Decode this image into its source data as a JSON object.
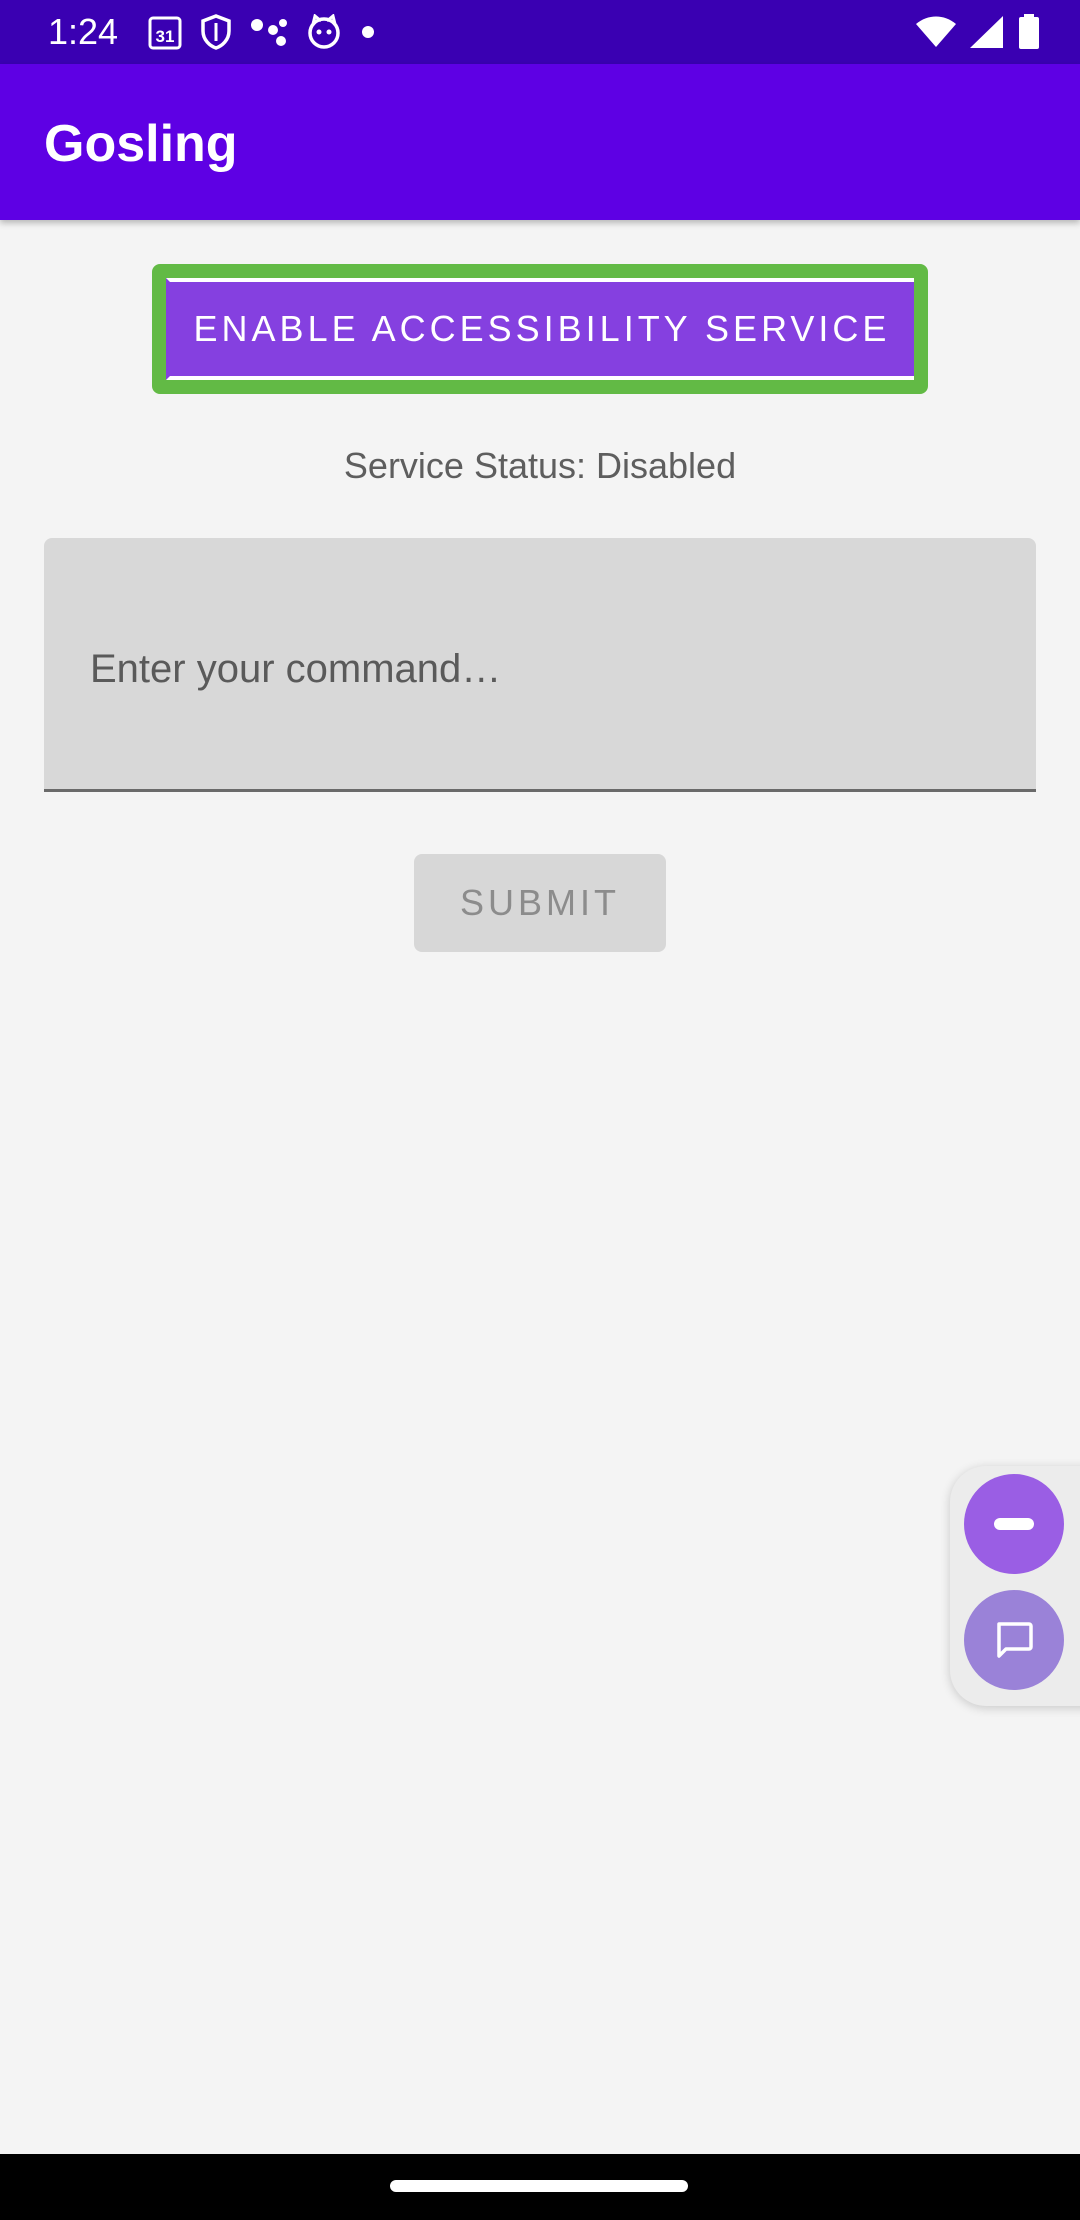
{
  "status_bar": {
    "time": "1:24",
    "left_icons": [
      "calendar-icon",
      "shield-icon",
      "dots-icon",
      "cat-icon",
      "notification-dot-icon"
    ],
    "calendar_text": "31",
    "right_icons": [
      "wifi-icon",
      "signal-icon",
      "battery-icon"
    ]
  },
  "app_bar": {
    "title": "Gosling"
  },
  "main": {
    "enable_button_label": "ENABLE ACCESSIBILITY SERVICE",
    "service_status": "Service Status: Disabled",
    "command_input": {
      "value": "",
      "placeholder": "Enter your command…"
    },
    "submit_label": "SUBMIT"
  },
  "floating_bubbles": {
    "icons": [
      "minimize-icon",
      "chat-icon"
    ]
  },
  "colors": {
    "status_bar": "#3a00b2",
    "app_bar": "#5e00e4",
    "primary_button": "#8540e0",
    "highlight_border": "#62ba45",
    "bubble": "#9a5ee4"
  }
}
